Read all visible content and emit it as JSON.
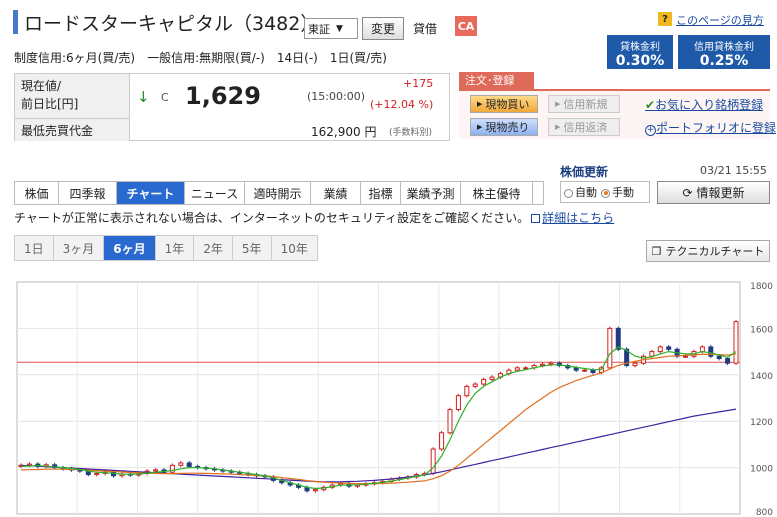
{
  "header": {
    "company": "ロードスターキャピタル（3482）",
    "market": "東証",
    "change_label": "変更",
    "taishaku": "貸借",
    "ca_badge": "CA",
    "help_icon": "?",
    "help_link": "このページの見方"
  },
  "rates": [
    {
      "label": "貸株金利",
      "value": "0.30%"
    },
    {
      "label": "信用貸株金利",
      "value": "0.25%"
    }
  ],
  "credit_line": "制度信用:6ヶ月(買/売)　一般信用:無期限(買/-)　14日(-)　1日(買/売)",
  "price": {
    "label_current": "現在値/",
    "label_prev": "前日比[円]",
    "arrow": "↓",
    "c_mark": "C",
    "value": "1,629",
    "time": "(15:00:00)",
    "change": "+175",
    "change_pct": "(+12.04 %)",
    "min_label": "最低売買代金",
    "min_value": "162,900 円",
    "fee_note": "(手数料別)"
  },
  "order": {
    "tab": "注文･登録",
    "buy": "現物買い",
    "sell": "現物売り",
    "credit_new": "信用新規",
    "credit_close": "信用返済",
    "fav": "お気に入り銘柄登録",
    "portfolio": "ポートフォリオに登録"
  },
  "tabs": [
    "株価",
    "四季報",
    "チャート",
    "ニュース",
    "適時開示",
    "業績",
    "指標",
    "業績予測",
    "株主優待"
  ],
  "active_tab": 2,
  "update": {
    "title": "株価更新",
    "time": "03/21 15:55",
    "auto": "自動",
    "manual": "手動",
    "refresh": "情報更新"
  },
  "notice": {
    "text": "チャートが正常に表示されない場合は、インターネットのセキュリティ設定をご確認ください。",
    "link": "詳細はこちら"
  },
  "periods": [
    "1日",
    "3ヶ月",
    "6ヶ月",
    "1年",
    "2年",
    "5年",
    "10年"
  ],
  "active_period": 2,
  "tech_button": "テクニカルチャート",
  "colors": {
    "accent": "#2a6ad0",
    "rise": "#d02020",
    "ma_short": "#2ab32a",
    "ma_mid": "#e07020",
    "ma_long": "#4020a0"
  },
  "chart_data": {
    "type": "line",
    "y_ticks": [
      "1800",
      "1600",
      "1400",
      "1200",
      "1000",
      "800"
    ],
    "ylim": [
      800,
      1800
    ],
    "reference_price": 1454,
    "close": [
      1010,
      1015,
      1005,
      1012,
      1000,
      995,
      990,
      985,
      970,
      975,
      980,
      965,
      972,
      968,
      975,
      985,
      990,
      980,
      1010,
      1020,
      1005,
      1000,
      995,
      990,
      985,
      980,
      975,
      970,
      965,
      960,
      945,
      935,
      925,
      915,
      900,
      905,
      915,
      925,
      930,
      920,
      925,
      930,
      935,
      940,
      950,
      955,
      960,
      970,
      975,
      1080,
      1150,
      1250,
      1310,
      1350,
      1360,
      1380,
      1390,
      1405,
      1420,
      1430,
      1430,
      1440,
      1445,
      1450,
      1440,
      1430,
      1420,
      1420,
      1410,
      1430,
      1600,
      1510,
      1440,
      1450,
      1480,
      1500,
      1520,
      1510,
      1480,
      1480,
      1500,
      1520,
      1480,
      1470,
      1450,
      1629
    ],
    "ma_short": [
      1005,
      1007,
      1008,
      1006,
      1003,
      1000,
      996,
      992,
      985,
      980,
      978,
      975,
      972,
      971,
      972,
      976,
      980,
      983,
      988,
      995,
      1000,
      1000,
      998,
      995,
      990,
      985,
      980,
      975,
      970,
      965,
      955,
      945,
      935,
      925,
      915,
      910,
      912,
      918,
      924,
      925,
      926,
      928,
      932,
      936,
      942,
      948,
      955,
      962,
      968,
      1000,
      1050,
      1120,
      1200,
      1270,
      1320,
      1350,
      1370,
      1390,
      1405,
      1415,
      1422,
      1430,
      1437,
      1443,
      1443,
      1438,
      1432,
      1427,
      1422,
      1422,
      1490,
      1520,
      1505,
      1480,
      1472,
      1478,
      1490,
      1500,
      1495,
      1490,
      1490,
      1500,
      1495,
      1485,
      1475,
      1500
    ],
    "ma_mid": [
      990,
      991,
      992,
      993,
      993,
      993,
      992,
      991,
      989,
      987,
      985,
      983,
      981,
      979,
      977,
      976,
      975,
      974,
      974,
      975,
      976,
      976,
      975,
      974,
      973,
      972,
      970,
      968,
      966,
      964,
      961,
      957,
      953,
      949,
      944,
      940,
      937,
      935,
      933,
      932,
      931,
      931,
      931,
      932,
      933,
      935,
      937,
      940,
      943,
      952,
      965,
      985,
      1010,
      1040,
      1070,
      1100,
      1130,
      1160,
      1190,
      1220,
      1250,
      1275,
      1300,
      1325,
      1345,
      1360,
      1375,
      1387,
      1398,
      1408,
      1425,
      1440,
      1450,
      1458,
      1465,
      1470,
      1475,
      1480,
      1482,
      1484,
      1486,
      1488,
      1488,
      1487,
      1485,
      1490
    ],
    "ma_long": [
      1010,
      1008,
      1006,
      1004,
      1002,
      1000,
      998,
      996,
      994,
      992,
      990,
      988,
      986,
      984,
      982,
      980,
      978,
      976,
      974,
      972,
      970,
      968,
      966,
      964,
      962,
      960,
      958,
      956,
      954,
      952,
      950,
      948,
      946,
      944,
      942,
      940,
      939,
      939,
      939,
      940,
      941,
      943,
      945,
      948,
      951,
      955,
      959,
      964,
      969,
      975,
      982,
      990,
      998,
      1006,
      1014,
      1022,
      1030,
      1038,
      1046,
      1054,
      1062,
      1070,
      1078,
      1086,
      1094,
      1102,
      1110,
      1118,
      1126,
      1134,
      1142,
      1150,
      1158,
      1166,
      1174,
      1182,
      1190,
      1198,
      1206,
      1214,
      1222,
      1228,
      1234,
      1240,
      1246,
      1252
    ]
  }
}
